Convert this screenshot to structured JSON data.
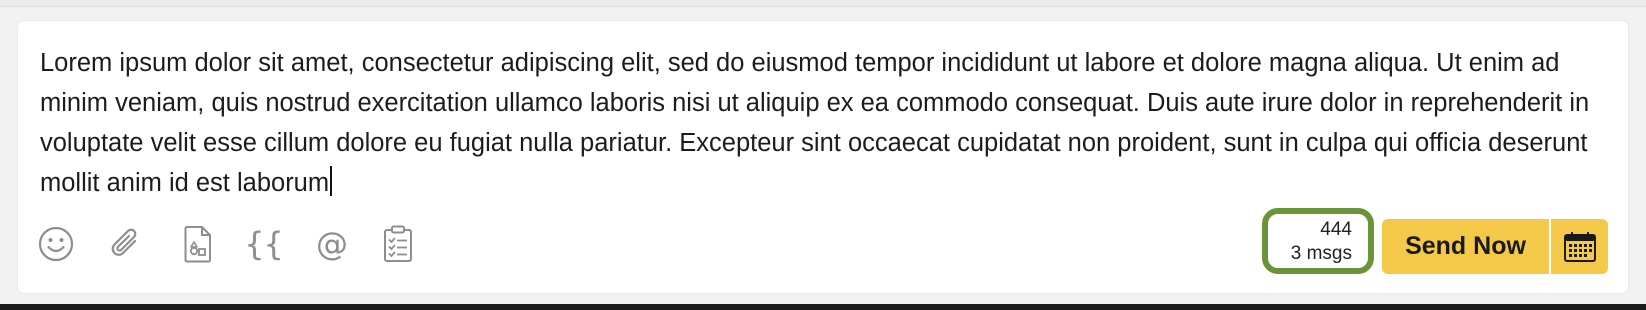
{
  "composer": {
    "message_text": "Lorem ipsum dolor sit amet, consectetur adipiscing elit, sed do eiusmod tempor incididunt ut labore et dolore magna aliqua. Ut enim ad minim veniam, quis nostrud exercitation ullamco laboris nisi ut aliquip ex ea commodo consequat. Duis aute irure dolor in reprehenderit in voluptate velit esse cillum dolore eu fugiat nulla pariatur. Excepteur sint occaecat cupidatat non proident, sunt in culpa qui officia deserunt mollit anim id est laborum"
  },
  "toolbar": {
    "icons": [
      "emoji-icon",
      "attachment-icon",
      "file-icon",
      "braces-icon",
      "mention-icon",
      "clipboard-icon"
    ],
    "braces_glyph": "{{",
    "mention_glyph": "@"
  },
  "counter": {
    "characters": "444",
    "messages": "3 msgs",
    "highlight_color": "#6a9437"
  },
  "actions": {
    "send_label": "Send Now",
    "schedule_icon": "calendar-icon",
    "button_color": "#f4c94a"
  }
}
